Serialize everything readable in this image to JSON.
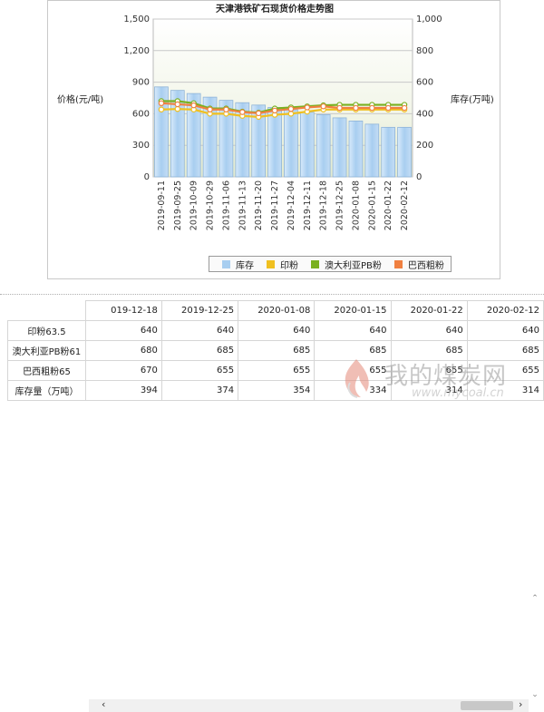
{
  "chart_data": {
    "type": "bar",
    "title": "天津港铁矿石现货价格走势图",
    "categories": [
      "2019-09-11",
      "2019-09-25",
      "2019-10-09",
      "2019-10-29",
      "2019-11-06",
      "2019-11-13",
      "2019-11-20",
      "2019-11-27",
      "2019-12-04",
      "2019-12-11",
      "2019-12-18",
      "2019-12-25",
      "2020-01-08",
      "2020-01-15",
      "2020-01-22",
      "2020-02-12"
    ],
    "y_left_label": "价格(元/吨)",
    "y_left_ticks": [
      "0",
      "300",
      "600",
      "900",
      "1,200",
      "1,500"
    ],
    "y_left_lim": [
      0,
      1500
    ],
    "y_right_label": "库存(万吨)",
    "y_right_ticks": [
      "0",
      "200",
      "400",
      "600",
      "800",
      "1,000"
    ],
    "y_right_lim": [
      0,
      1000
    ],
    "series": [
      {
        "name": "库存",
        "type": "bar",
        "axis": "right",
        "color": "#a8cef0",
        "values": [
          570,
          548,
          528,
          505,
          485,
          470,
          455,
          440,
          425,
          410,
          394,
          374,
          354,
          334,
          314,
          314
        ]
      },
      {
        "name": "印粉",
        "type": "line",
        "axis": "left",
        "color": "#f0c020",
        "values": [
          640,
          645,
          640,
          600,
          600,
          580,
          570,
          590,
          600,
          620,
          640,
          640,
          640,
          640,
          640,
          640
        ]
      },
      {
        "name": "澳大利亚PB粉",
        "type": "line",
        "axis": "left",
        "color": "#7ab020",
        "values": [
          720,
          720,
          700,
          650,
          650,
          620,
          610,
          650,
          660,
          670,
          680,
          685,
          685,
          685,
          685,
          685
        ]
      },
      {
        "name": "巴西粗粉",
        "type": "line",
        "axis": "left",
        "color": "#f08040",
        "values": [
          700,
          690,
          680,
          640,
          640,
          615,
          605,
          630,
          645,
          660,
          670,
          655,
          655,
          655,
          655,
          655
        ]
      }
    ],
    "grid": true,
    "legend": "bottom"
  },
  "table": {
    "columns": [
      "2019-12-18",
      "2019-12-25",
      "2020-01-08",
      "2020-01-15",
      "2020-01-22",
      "2020-02-12"
    ],
    "first_col_display": "019-12-18",
    "last_col_display": "2020-02-12",
    "rows": [
      {
        "label": "印粉63.5",
        "values": [
          "640",
          "640",
          "640",
          "640",
          "640",
          "640"
        ]
      },
      {
        "label": "澳大利亚PB粉61",
        "values": [
          "680",
          "685",
          "685",
          "685",
          "685",
          "685"
        ]
      },
      {
        "label": "巴西粗粉65",
        "values": [
          "670",
          "655",
          "655",
          "655",
          "655",
          "655"
        ]
      },
      {
        "label": "库存量（万吨）",
        "values": [
          "394",
          "374",
          "354",
          "334",
          "314",
          "314"
        ]
      }
    ]
  },
  "scroll": {
    "left": "‹",
    "right": "›",
    "up": "⌃",
    "down": "⌄"
  },
  "watermark": {
    "text": "我的煤炭网",
    "url": "www.mycoal.cn"
  }
}
